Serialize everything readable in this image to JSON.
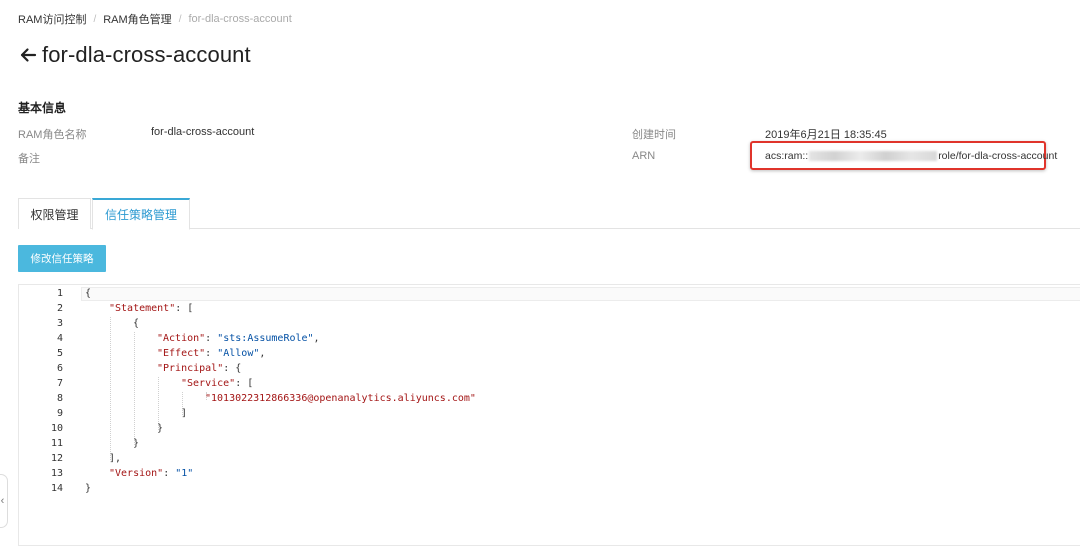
{
  "breadcrumb": {
    "items": [
      "RAM访问控制",
      "RAM角色管理",
      "for-dla-cross-account"
    ]
  },
  "header": {
    "title": "for-dla-cross-account"
  },
  "basic_info": {
    "section_title": "基本信息",
    "role_name_label": "RAM角色名称",
    "role_name_value": "for-dla-cross-account",
    "note_label": "备注",
    "note_value": "",
    "created_label": "创建时间",
    "created_value": "2019年6月21日 18:35:45",
    "arn_label": "ARN",
    "arn_prefix": "acs:ram::",
    "arn_suffix": "role/for-dla-cross-account"
  },
  "tabs": [
    {
      "label": "权限管理",
      "active": false
    },
    {
      "label": "信任策略管理",
      "active": true
    }
  ],
  "edit_button": {
    "label": "修改信任策略"
  },
  "editor": {
    "line_numbers": [
      "1",
      "2",
      "3",
      "4",
      "5",
      "6",
      "7",
      "8",
      "9",
      "10",
      "11",
      "12",
      "13",
      "14"
    ],
    "code": {
      "statement_key": "\"Statement\"",
      "action_key": "\"Action\"",
      "action_value": "\"sts:AssumeRole\"",
      "effect_key": "\"Effect\"",
      "effect_value": "\"Allow\"",
      "principal_key": "\"Principal\"",
      "service_key": "\"Service\"",
      "service_value": "\"1013022312866336@openanalytics.aliyuncs.com\"",
      "version_key": "\"Version\"",
      "version_value": "\"1\""
    }
  },
  "colors": {
    "accent": "#4bb8de",
    "active_tab": "#2d9ad1",
    "highlight_box": "#e0342b",
    "json_key": "#a31515",
    "json_string": "#0451a5"
  }
}
